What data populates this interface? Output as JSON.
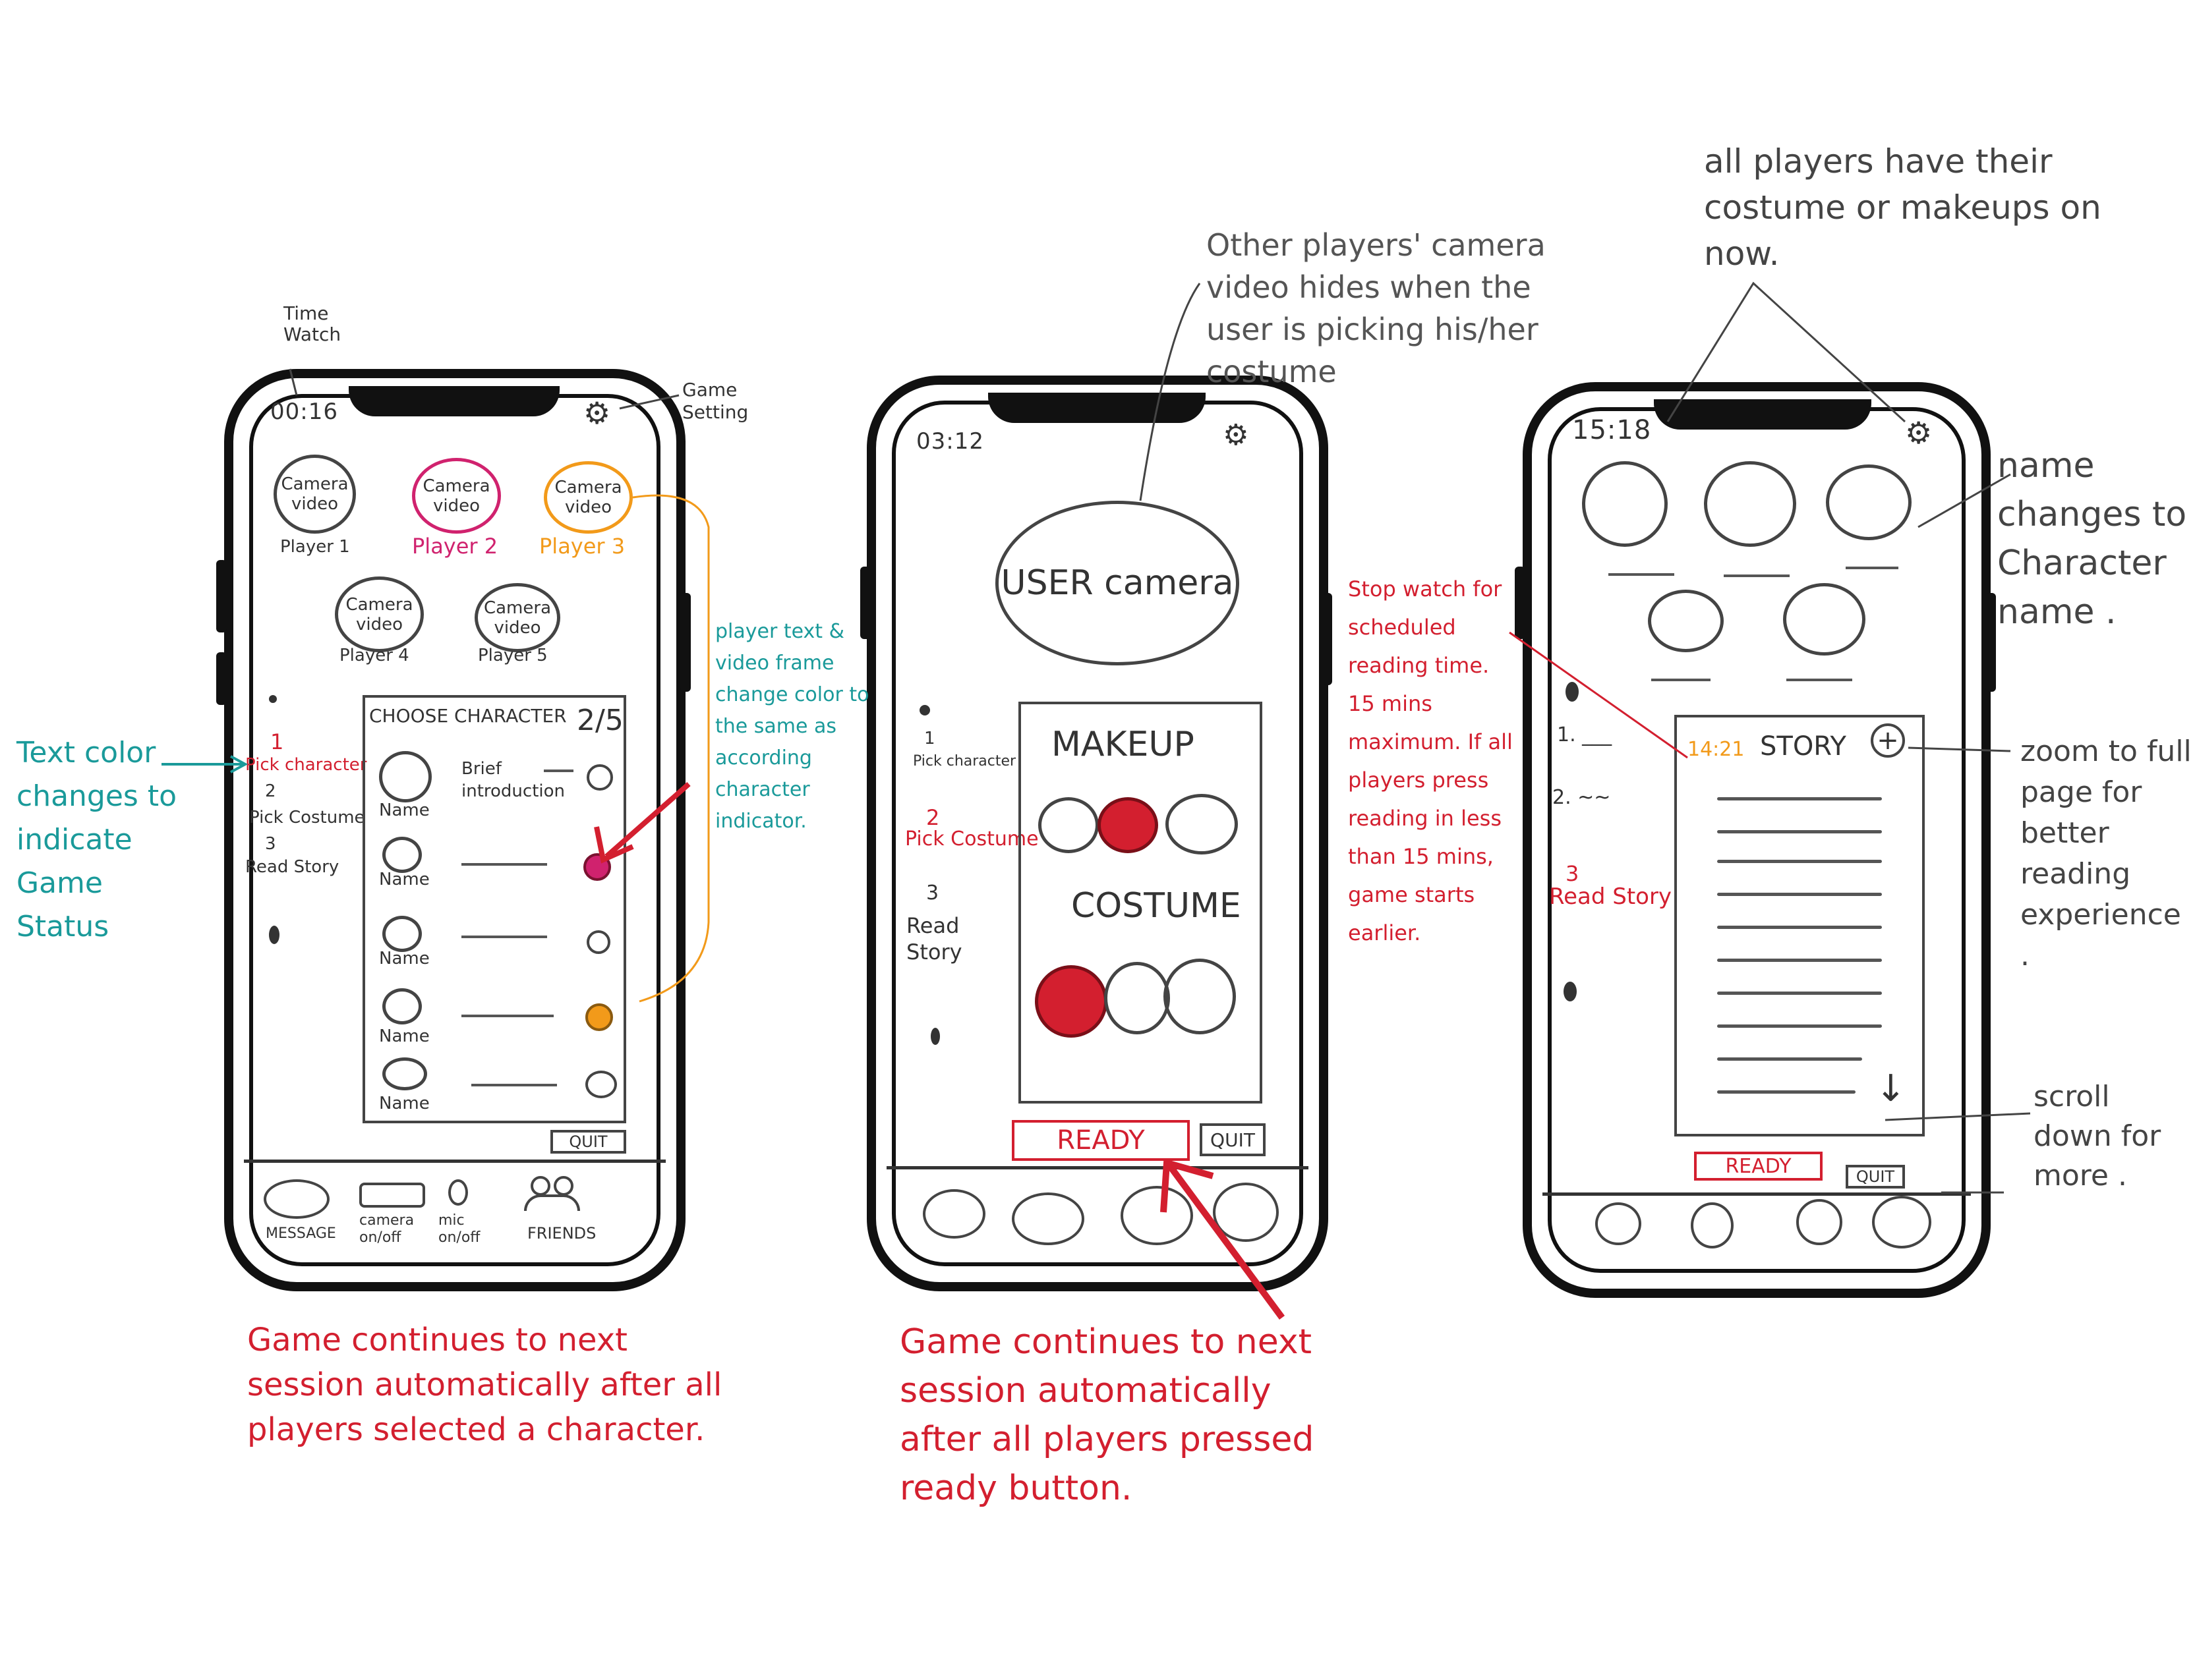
{
  "phone1": {
    "time": "00:16",
    "cameras": [
      {
        "text": "Camera video",
        "player": "Player 1"
      },
      {
        "text": "Camera video",
        "player": "Player 2"
      },
      {
        "text": "Camera video",
        "player": "Player 3"
      },
      {
        "text": "Camera video",
        "player": "Player 4"
      },
      {
        "text": "Camera video",
        "player": "Player 5"
      }
    ],
    "steps": {
      "s1_num": "1",
      "s1_label": "Pick character",
      "s2_num": "2",
      "s2_label": "Pick Costume",
      "s3_num": "3",
      "s3_label": "Read Story"
    },
    "panel": {
      "title": "CHOOSE CHARACTER",
      "count": "2/5",
      "brief": "Brief introduction",
      "names": [
        "Name",
        "Name",
        "Name",
        "Name",
        "Name"
      ]
    },
    "quit": "QUIT",
    "bottom": {
      "message": "MESSAGE",
      "camera": "camera on/off",
      "mic": "mic on/off",
      "friends": "FRIENDS"
    }
  },
  "phone2": {
    "time": "03:12",
    "user_camera": "USER camera",
    "steps": {
      "s1_num": "1",
      "s1_label": "Pick character",
      "s2_num": "2",
      "s2_label": "Pick Costume",
      "s3_num": "3",
      "s3_label": "Read Story"
    },
    "makeup": "MAKEUP",
    "costume": "COSTUME",
    "ready": "READY",
    "quit": "QUIT"
  },
  "phone3": {
    "time": "15:18",
    "steps": {
      "s1": "1. ___",
      "s2": "2. ~~",
      "s3_num": "3",
      "s3_label": "Read Story"
    },
    "timer": "14:21",
    "story": "STORY",
    "ready": "READY",
    "quit": "QUIT"
  },
  "annotations": {
    "time_watch": "Time Watch",
    "game_setting": "Game Setting",
    "text_color": "Text color changes to indicate Game Status",
    "player_text": "player text & video frame change color to the same as according character indicator.",
    "other_players": "Other players' camera video hides when the user is picking his/her costume",
    "all_players": "all players have their costume or makeups on now.",
    "name_changes": "name changes to Character name .",
    "stopwatch": "Stop watch for scheduled reading time. 15 mins maximum. If all players press reading in less than 15 mins, game starts earlier.",
    "zoom": "zoom to full page for better reading experience .",
    "scroll": "scroll down for more .",
    "caption1": "Game continues to next session automatically after all players selected a character.",
    "caption2": "Game continues to next session automatically after all players pressed ready button."
  },
  "colors": {
    "red": "#d31f2f",
    "orange": "#f29a1a",
    "teal": "#1a9a9a",
    "magenta": "#d0226e"
  }
}
